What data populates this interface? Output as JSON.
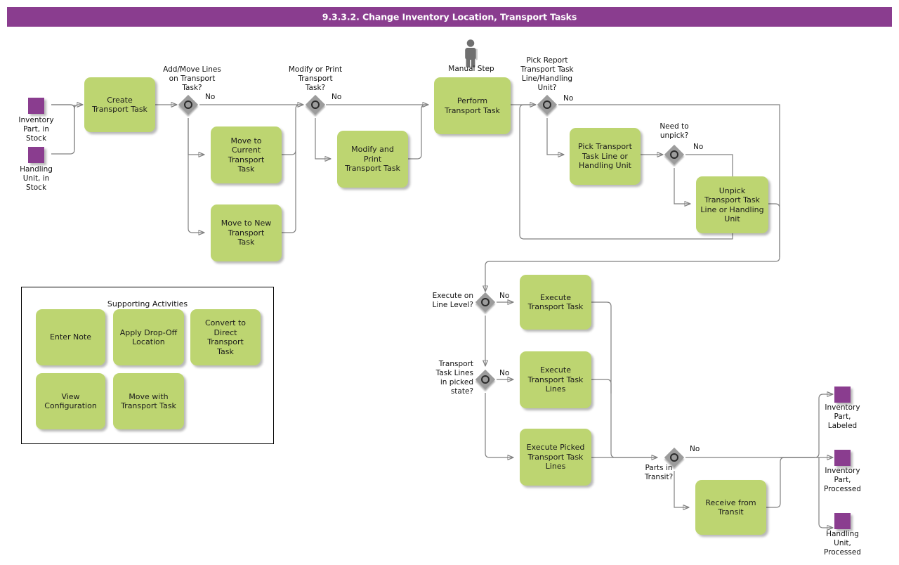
{
  "header": {
    "title": "9.3.3.2. Change Inventory Location, Transport Tasks",
    "bar_color": "#8a3d8f"
  },
  "theme": {
    "task_fill": "#bdd571",
    "event_fill": "#8a3d8f",
    "gateway_fill": "#9c9c9c",
    "edge_color": "#808080",
    "text_color": "#111111"
  },
  "start_events": [
    {
      "id": "start-inventory-part-in-stock",
      "label": "Inventory\nPart, in\nStock"
    },
    {
      "id": "start-handling-unit-in-stock",
      "label": "Handling\nUnit, in\nStock"
    }
  ],
  "end_events": [
    {
      "id": "end-inventory-part-labeled",
      "label": "Inventory\nPart,\nLabeled"
    },
    {
      "id": "end-inventory-part-processed",
      "label": "Inventory\nPart,\nProcessed"
    },
    {
      "id": "end-handling-unit-processed",
      "label": "Handling\nUnit,\nProcessed"
    }
  ],
  "tasks": [
    {
      "id": "create-transport-task",
      "label": "Create\nTransport Task"
    },
    {
      "id": "move-to-current-transport-task",
      "label": "Move to\nCurrent\nTransport\nTask"
    },
    {
      "id": "move-to-new-transport-task",
      "label": "Move to New\nTransport\nTask"
    },
    {
      "id": "modify-and-print-transport-task",
      "label": "Modify and Print\nTransport Task"
    },
    {
      "id": "perform-transport-task",
      "label": "Perform\nTransport Task"
    },
    {
      "id": "pick-transport-task-line-or-handling-unit",
      "label": "Pick Transport\nTask Line or\nHandling Unit"
    },
    {
      "id": "unpick-transport-task-line-or-handling-unit",
      "label": "Unpick\nTransport Task\nLine or Handling\nUnit"
    },
    {
      "id": "execute-transport-task",
      "label": "Execute\nTransport Task"
    },
    {
      "id": "execute-transport-task-lines",
      "label": "Execute\nTransport Task\nLines"
    },
    {
      "id": "execute-picked-transport-task-lines",
      "label": "Execute Picked\nTransport Task\nLines"
    },
    {
      "id": "receive-from-transit",
      "label": "Receive from\nTransit"
    }
  ],
  "gateways": [
    {
      "id": "gw-add-move-lines",
      "label": "Add/Move Lines\non Transport\nTask?",
      "branch_label": "No"
    },
    {
      "id": "gw-modify-or-print",
      "label": "Modify or Print\nTransport\nTask?",
      "branch_label": "No"
    },
    {
      "id": "gw-pick-report",
      "label": "Pick Report\nTransport Task\nLine/Handling\nUnit?",
      "branch_label": "No"
    },
    {
      "id": "gw-need-to-unpick",
      "label": "Need to\nunpick?",
      "branch_label": "No"
    },
    {
      "id": "gw-execute-on-line-level",
      "label": "Execute on\nLine Level?",
      "branch_label": "No"
    },
    {
      "id": "gw-lines-in-picked-state",
      "label": "Transport\nTask Lines\nin picked\nstate?",
      "branch_label": "No"
    },
    {
      "id": "gw-parts-in-transit",
      "label": "Parts in\nTransit?",
      "branch_label": "No"
    }
  ],
  "manual_step": {
    "id": "manual-step",
    "label": "Manual Step",
    "icon": "person-icon"
  },
  "supporting_activities": {
    "title": "Supporting Activities",
    "items": [
      {
        "id": "enter-note",
        "label": "Enter Note"
      },
      {
        "id": "apply-drop-off-location",
        "label": "Apply Drop-Off\nLocation"
      },
      {
        "id": "convert-to-direct-transport-task",
        "label": "Convert to\nDirect Transport\nTask"
      },
      {
        "id": "view-configuration",
        "label": "View\nConfiguration"
      },
      {
        "id": "move-with-transport-task",
        "label": "Move with\nTransport Task"
      }
    ]
  }
}
